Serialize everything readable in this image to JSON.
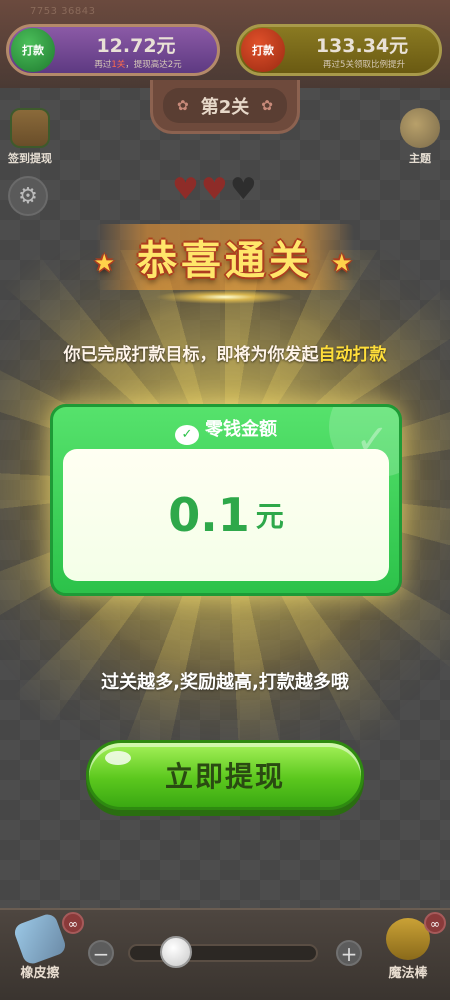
{
  "header": {
    "top_id": "7753 36843",
    "left_pill": {
      "icon": "wechat-cash-icon",
      "icon_label": "打款",
      "amount": "12.72元",
      "note_prefix": "再过",
      "note_highlight": "1关",
      "note_suffix": "，提现高达2元"
    },
    "right_pill": {
      "icon": "yuan-calendar-icon",
      "icon_label": "打款",
      "amount": "133.34元",
      "note": "再过5关领取比例提升"
    },
    "level": "第2关"
  },
  "side": {
    "checkin_label": "签到提现",
    "theme_label": "主题"
  },
  "hearts": {
    "filled": 2,
    "total": 3
  },
  "dialog": {
    "title": "恭喜通关",
    "subtitle_main": "你已完成打款目标，即将为你发起",
    "subtitle_accent": "自动打款",
    "card_header": "零钱金额",
    "amount_value": "0.1",
    "amount_unit": "元",
    "tip": "过关越多,奖励越高,打款越多哦",
    "cta_label": "立即提现"
  },
  "toolbar": {
    "eraser_label": "橡皮擦",
    "eraser_badge": "∞",
    "wand_label": "魔法棒",
    "wand_badge": "∞",
    "minus": "−",
    "plus": "+",
    "slider_value": 0.2
  },
  "colors": {
    "accent_green": "#2cc24a",
    "cta_green": "#5cc81e",
    "title_yellow": "#ffe66a",
    "subtitle_accent": "#ffde3a"
  }
}
